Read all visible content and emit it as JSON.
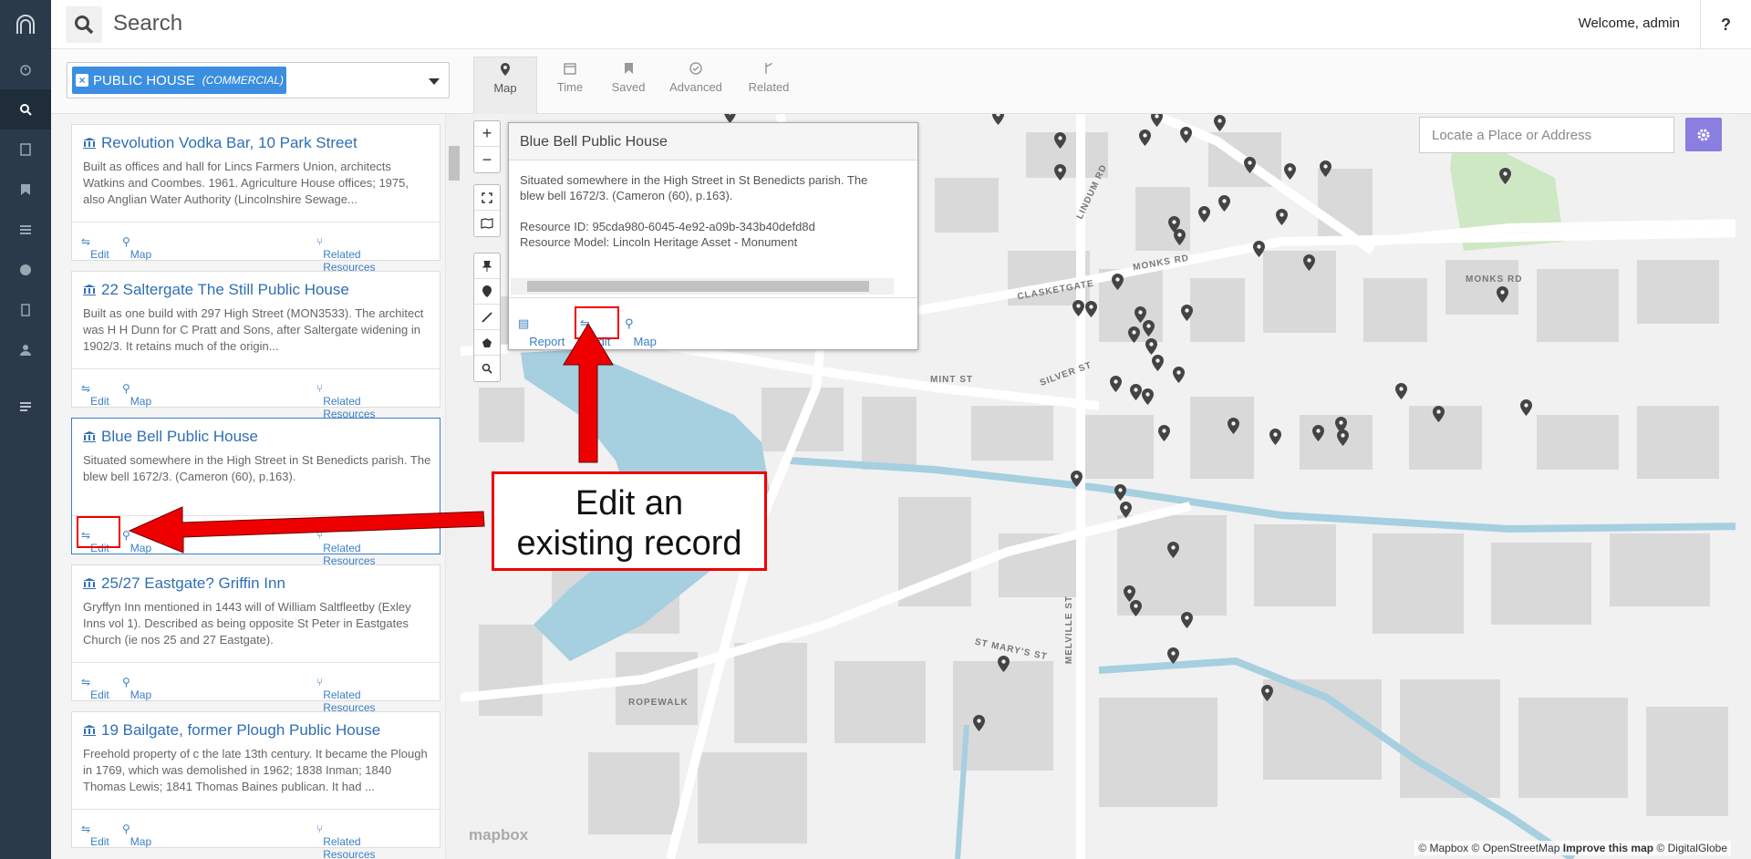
{
  "header": {
    "search_title": "Search",
    "welcome": "Welcome, admin",
    "help": "?"
  },
  "sidebar": {
    "items": [
      "logo-icon",
      "dashboard-icon",
      "search-icon",
      "resources-icon",
      "bookmark-icon",
      "list-icon",
      "globe-icon",
      "document-icon",
      "user-icon",
      "menu-icon"
    ]
  },
  "filter": {
    "tag_label": "PUBLIC HOUSE",
    "tag_sub": "(COMMERCIAL)"
  },
  "tabs": [
    {
      "label": "Map"
    },
    {
      "label": "Time"
    },
    {
      "label": "Saved"
    },
    {
      "label": "Advanced"
    },
    {
      "label": "Related"
    }
  ],
  "results": [
    {
      "title": "Revolution Vodka Bar, 10 Park Street",
      "desc": "Built as offices and hall for Lincs Farmers Union, architects Watkins and Coombes. 1961. Agriculture House offices; 1975, also Anglian Water Authority (Lincolnshire Sewage...",
      "edit": "Edit",
      "map": "Map",
      "related": "Related Resources"
    },
    {
      "title": "22 Saltergate The Still Public House",
      "desc": "Built as one build with 297 High Street (MON3533). The architect was H H Dunn for C Pratt and Sons, after Saltergate widening in 1902/3. It retains much of the origin...",
      "edit": "Edit",
      "map": "Map",
      "related": "Related Resources"
    },
    {
      "title": "Blue Bell Public House",
      "desc": "Situated somewhere in the High Street in St Benedicts parish. The blew bell 1672/3. (Cameron (60), p.163).",
      "edit": "Edit",
      "map": "Map",
      "related": "Related Resources"
    },
    {
      "title": "25/27 Eastgate? Griffin Inn",
      "desc": "Gryffyn Inn mentioned in 1443 will of William Saltfleetby (Exley Inns vol 1). Described as being opposite St Peter in Eastgates Church (ie nos 25 and 27 Eastgate).",
      "edit": "Edit",
      "map": "Map",
      "related": "Related Resources"
    },
    {
      "title": "19 Bailgate, former Plough Public House",
      "desc": "Freehold property of c the late 13th century. It became the Plough in 1769, which was demolished in 1962; 1838 Inman; 1840 Thomas Lewis; 1841 Thomas Baines publican. It had ...",
      "edit": "Edit",
      "map": "Map",
      "related": "Related Resources"
    }
  ],
  "popup": {
    "title": "Blue Bell Public House",
    "desc": "Situated somewhere in the High Street in St Benedicts parish. The blew bell 1672/3. (Cameron (60), p.163).",
    "resource_id": "Resource ID: 95cda980-6045-4e92-a09b-343b40defd8d",
    "resource_model": "Resource Model: Lincoln Heritage Asset - Monument",
    "report": "Report",
    "edit": "Edit",
    "map": "Map"
  },
  "callout": {
    "line1": "Edit an",
    "line2": "existing record"
  },
  "map": {
    "locate_placeholder": "Locate a Place or Address",
    "attribution_a": "© Mapbox © OpenStreetMap",
    "attribution_b": "Improve this map",
    "attribution_c": "© DigitalGlobe",
    "mapbox_logo": "mapbox",
    "roads": [
      "MONKS RD",
      "MONKS RD",
      "CLASKETGATE",
      "LINDUM RD",
      "MINT ST",
      "SILVER ST",
      "ST MARY'S ST",
      "ROPEWALK",
      "MELVILLE ST"
    ]
  },
  "colors": {
    "sidebar": "#2b3a4a",
    "accent": "#3b8ee0",
    "link": "#2f6fb2",
    "annotation": "#e00000",
    "water": "#a6cfe0",
    "park": "#cfe8c4"
  }
}
